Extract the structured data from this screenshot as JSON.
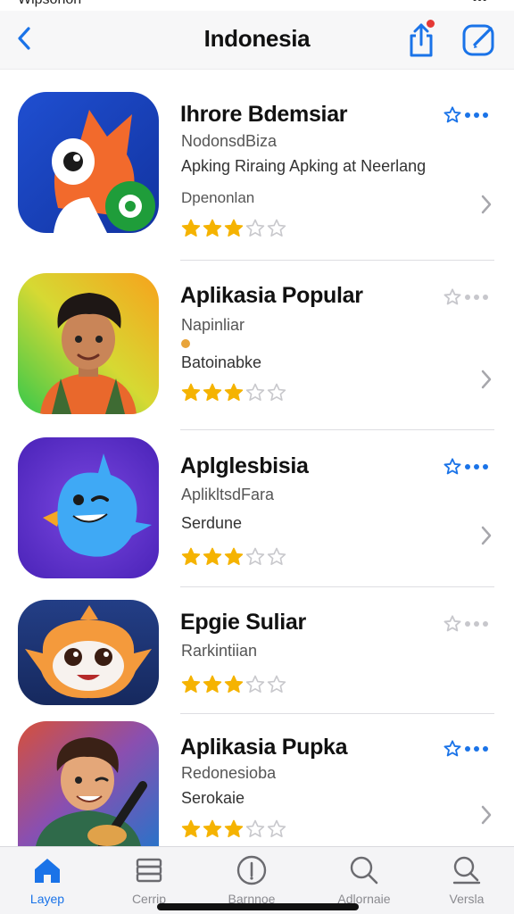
{
  "status": {
    "left": "Wipsonon",
    "right": "•••"
  },
  "nav": {
    "title": "Indonesia",
    "back_icon": "chevron-left-icon",
    "share_icon": "share-icon",
    "compose_icon": "compose-icon",
    "accent": "#1a73e8",
    "badge_color": "#e53935"
  },
  "apps": [
    {
      "title": "Ihrore Bdemsiar",
      "sub": "NodonsdBiza",
      "desc": "Apking Riraing Apking at Neerlang",
      "extra": "Dpenonlan",
      "rating": 3,
      "max_rating": 5,
      "favorited": true
    },
    {
      "title": "Aplikasia Popular",
      "sub": "Napinliar",
      "desc": "Batoinabke",
      "rating": 3,
      "max_rating": 5,
      "favorited": false
    },
    {
      "title": "Aplglesbisia",
      "sub": "AplikltsdFara",
      "desc": "Serdune",
      "rating": 3,
      "max_rating": 5,
      "favorited": true
    },
    {
      "title": "Epgie Suliar",
      "sub": "Rarkintiian",
      "rating": 3,
      "max_rating": 5,
      "favorited": false
    },
    {
      "title": "Aplikasia Pupka",
      "sub": "Redonesioba",
      "desc": "Serokaie",
      "rating": 3,
      "max_rating": 5,
      "favorited": true
    }
  ],
  "tabs": [
    {
      "label": "Layep",
      "icon": "home-icon",
      "active": true
    },
    {
      "label": "Cerrip",
      "icon": "stack-icon",
      "active": false
    },
    {
      "label": "Barnnoe",
      "icon": "info-icon",
      "active": false
    },
    {
      "label": "Adlornaie",
      "icon": "search-icon",
      "active": false
    },
    {
      "label": "Versla",
      "icon": "search-icon",
      "active": false
    }
  ],
  "colors": {
    "star": "#f5b301",
    "star_empty": "#c8c8cc",
    "fav_active": "#1a73e8",
    "fav_inactive": "#c7c7cc",
    "tab_active": "#1a73e8"
  }
}
